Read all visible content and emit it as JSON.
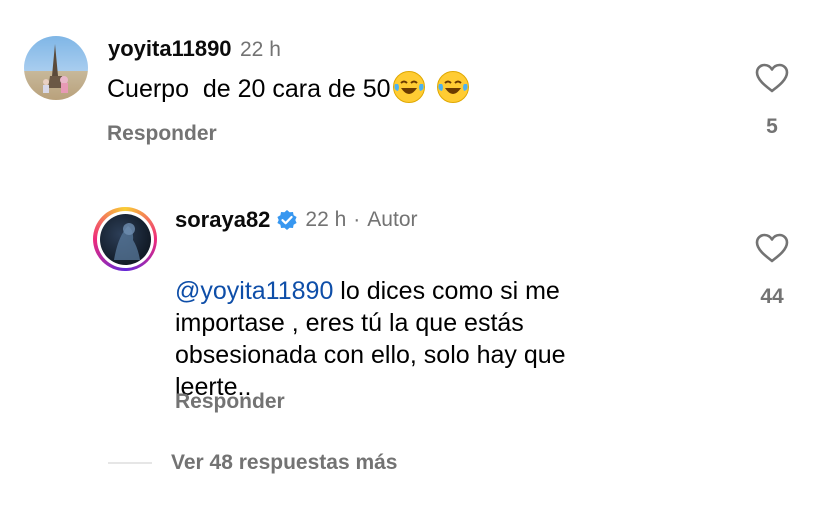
{
  "comments": [
    {
      "username": "yoyita11890",
      "time": "22 h",
      "text": "Cuerpo  de 20 cara de 50",
      "emojis": [
        "face-with-tears-of-joy",
        "face-with-tears-of-joy"
      ],
      "reply_label": "Responder",
      "likes": "5"
    }
  ],
  "reply": {
    "username": "soraya82",
    "verified": true,
    "time": "22 h",
    "separator": "·",
    "author_tag": "Autor",
    "mention": "@yoyita11890",
    "lines": [
      " lo dices como si me",
      "importase , eres tú la que estás",
      "obsesionada con ello, solo hay que",
      "leerte.."
    ],
    "reply_label": "Responder",
    "likes": "44"
  },
  "more_replies": "Ver 48 respuestas más",
  "colors": {
    "mention": "#0e4ea8",
    "secondary_text": "#737373",
    "verified": "#3797f0"
  }
}
